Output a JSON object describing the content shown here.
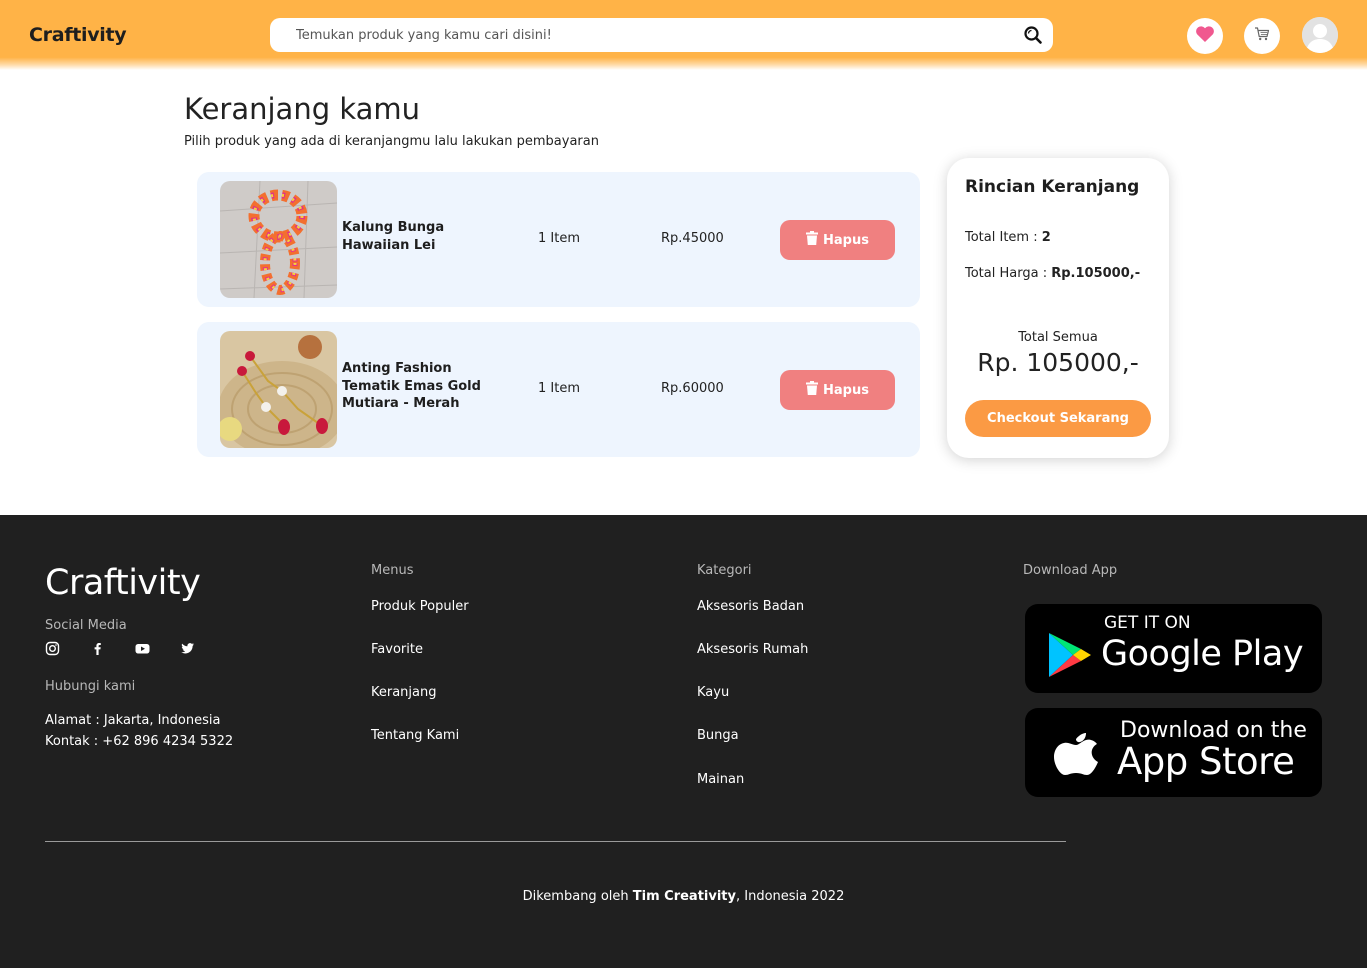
{
  "header": {
    "logo": "Craftivity",
    "search_placeholder": "Temukan produk yang kamu cari disini!",
    "icons": [
      "search-icon",
      "heart-icon",
      "cart-icon",
      "user-avatar"
    ]
  },
  "main": {
    "title": "Keranjang kamu",
    "subtitle": "Pilih produk yang ada di keranjangmu lalu lakukan pembayaran",
    "items": [
      {
        "name": "Kalung Bunga Hawaiian Lei",
        "qty": "1 Item",
        "price": "Rp.45000",
        "delete_label": "Hapus"
      },
      {
        "name": "Anting Fashion Tematik Emas Gold Mutiara - Merah",
        "qty": "1 Item",
        "price": "Rp.60000",
        "delete_label": "Hapus"
      }
    ]
  },
  "summary": {
    "title": "Rincian Keranjang",
    "total_item_label": "Total Item :",
    "total_item_value": "2",
    "total_price_label": "Total Harga :",
    "total_price_value": "Rp.105000,-",
    "total_all_label": "Total Semua",
    "total_all_value": "Rp. 105000,-",
    "checkout_label": "Checkout Sekarang"
  },
  "footer": {
    "brand": "Craftivity",
    "social_label": "Social Media",
    "social_icons": [
      "instagram-icon",
      "facebook-icon",
      "youtube-icon",
      "twitter-icon"
    ],
    "contact_label": "Hubungi kami",
    "address": "Alamat : Jakarta, Indonesia",
    "contact": "Kontak : +62 896 4234 5322",
    "menus_label": "Menus",
    "menus": [
      "Produk Populer",
      "Favorite",
      "Keranjang",
      "Tentang Kami"
    ],
    "category_label": "Kategori",
    "categories": [
      "Aksesoris Badan",
      "Aksesoris Rumah",
      "Kayu",
      "Bunga",
      "Mainan"
    ],
    "download_label": "Download App",
    "google_play_small": "GET IT ON",
    "google_play_big": "Google Play",
    "app_store_small": "Download on the",
    "app_store_big": "App Store",
    "copyright_prefix": "Dikembang oleh",
    "copyright_team": "Tim Creativity",
    "copyright_suffix": ", Indonesia 2022"
  },
  "colors": {
    "header": "#ffb347",
    "delete_button": "#f08080",
    "checkout_button": "#fb9a44",
    "cart_item_bg": "#eef5fe",
    "footer_bg": "#202020",
    "heart": "#f0588f"
  }
}
